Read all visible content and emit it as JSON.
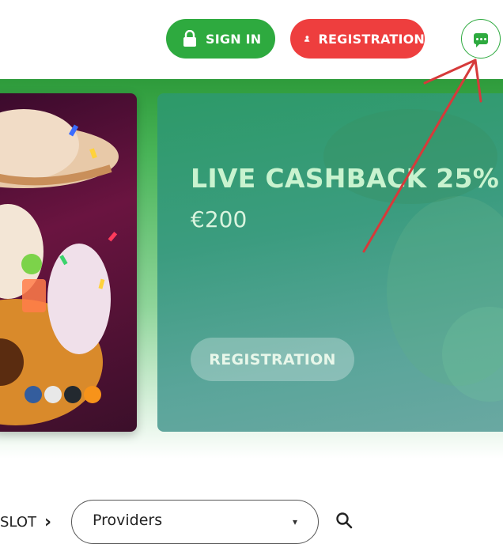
{
  "header": {
    "signin_label": "SIGN IN",
    "registration_label": "REGISTRATION"
  },
  "banner": {
    "promo_title": "LIVE CASHBACK 25%",
    "promo_amount": "€200",
    "promo_button_label": "REGISTRATION"
  },
  "filters": {
    "category_label": "SLOT",
    "providers_label": "Providers"
  },
  "colors": {
    "green": "#2eaa3f",
    "red": "#ee3e3e"
  },
  "icons": [
    "lock-icon",
    "user-plus-icon",
    "chat-icon",
    "chevron-right-icon",
    "chevron-down-icon",
    "search-icon"
  ]
}
